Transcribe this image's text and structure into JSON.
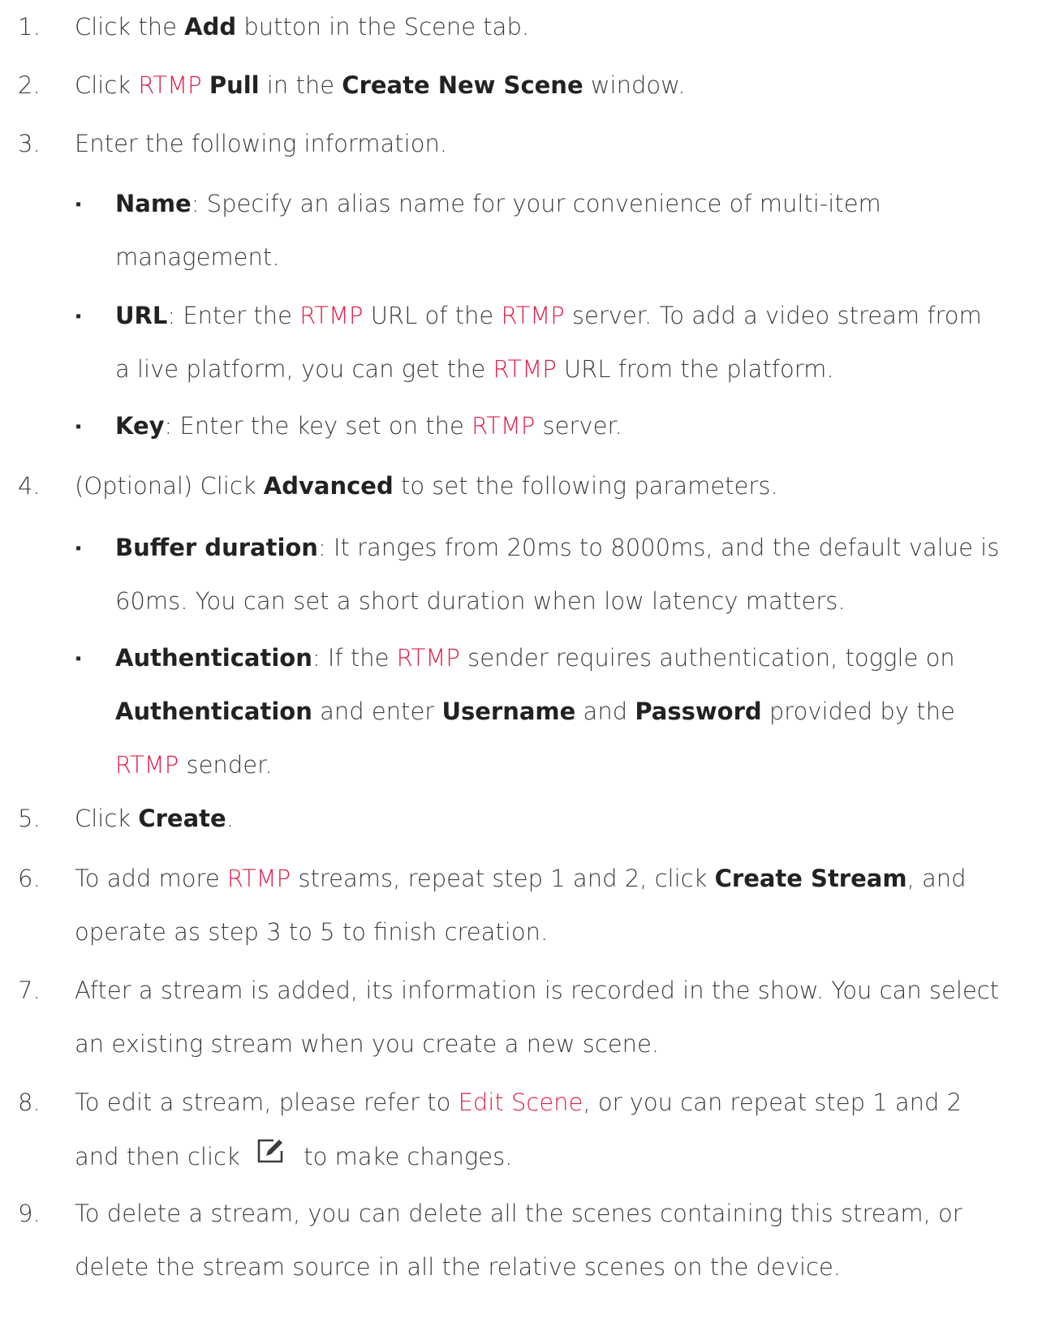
{
  "colors": {
    "accent": "#e0204a",
    "text": "#3c3c3c"
  },
  "steps": [
    {
      "num": "1.",
      "parts": [
        {
          "t": "Click the "
        },
        {
          "t": "Add",
          "b": true
        },
        {
          "t": " button in the Scene tab."
        }
      ]
    },
    {
      "num": "2.",
      "parts": [
        {
          "t": "Click "
        },
        {
          "t": "RTMP",
          "r": true
        },
        {
          "t": " "
        },
        {
          "t": "Pull",
          "b": true
        },
        {
          "t": " in the "
        },
        {
          "t": "Create New Scene",
          "b": true
        },
        {
          "t": " window."
        }
      ]
    },
    {
      "num": "3.",
      "parts": [
        {
          "t": "Enter the following information."
        }
      ]
    },
    {
      "num": "4.",
      "parts": [
        {
          "t": "(Optional) Click "
        },
        {
          "t": "Advanced",
          "b": true
        },
        {
          "t": " to set the following parameters."
        }
      ]
    },
    {
      "num": "5.",
      "parts": [
        {
          "t": "Click "
        },
        {
          "t": "Create",
          "b": true
        },
        {
          "t": "."
        }
      ]
    },
    {
      "num": "6.",
      "line1": [
        {
          "t": "To add more "
        },
        {
          "t": "RTMP",
          "r": true
        },
        {
          "t": " streams, repeat step 1 and 2, click "
        },
        {
          "t": "Create Stream",
          "b": true
        },
        {
          "t": ", and"
        }
      ],
      "line2": [
        {
          "t": "operate as step 3 to 5 to finish creation."
        }
      ]
    },
    {
      "num": "7.",
      "line1": [
        {
          "t": "After a stream is added, its information is recorded in the show. You can select"
        }
      ],
      "line2": [
        {
          "t": "an existing stream when you create a new scene."
        }
      ]
    },
    {
      "num": "8.",
      "line1": [
        {
          "t": "To edit a stream, please refer to "
        },
        {
          "t": "Edit Scene",
          "r": true
        },
        {
          "t": ", or you can repeat step 1 and 2"
        }
      ],
      "line2_before": "and then click",
      "line2_after": "to make changes.",
      "icon": "edit-icon"
    },
    {
      "num": "9.",
      "line1": [
        {
          "t": "To delete a stream, you can delete all the scenes containing this stream, or"
        }
      ],
      "line2": [
        {
          "t": "delete the stream source in all the relative scenes on the device."
        }
      ]
    }
  ],
  "sub3": [
    {
      "line1": [
        {
          "t": "Name",
          "b": true
        },
        {
          "t": ": Specify an alias name for your convenience of multi-item"
        }
      ],
      "line2": [
        {
          "t": "management."
        }
      ]
    },
    {
      "line1": [
        {
          "t": "URL",
          "b": true
        },
        {
          "t": ": Enter the "
        },
        {
          "t": "RTMP",
          "r": true
        },
        {
          "t": " URL of the "
        },
        {
          "t": "RTMP",
          "r": true
        },
        {
          "t": " server. To add a video stream from"
        }
      ],
      "line2": [
        {
          "t": "a live platform, you can get the "
        },
        {
          "t": "RTMP",
          "r": true
        },
        {
          "t": " URL from the platform."
        }
      ]
    },
    {
      "line1": [
        {
          "t": "Key",
          "b": true
        },
        {
          "t": ": Enter the key set on the "
        },
        {
          "t": "RTMP",
          "r": true
        },
        {
          "t": " server."
        }
      ]
    }
  ],
  "sub4": [
    {
      "line1": [
        {
          "t": "Buffer duration",
          "b": true
        },
        {
          "t": ": It ranges from 20ms to 8000ms, and the default value is"
        }
      ],
      "line2": [
        {
          "t": "60ms. You can set a short duration when low latency matters."
        }
      ]
    },
    {
      "line1": [
        {
          "t": "Authentication",
          "b": true
        },
        {
          "t": ": If the "
        },
        {
          "t": "RTMP",
          "r": true
        },
        {
          "t": " sender requires authentication, toggle on"
        }
      ],
      "line2": [
        {
          "t": "Authentication",
          "b": true
        },
        {
          "t": " and enter "
        },
        {
          "t": "Username",
          "b": true
        },
        {
          "t": " and "
        },
        {
          "t": "Password",
          "b": true
        },
        {
          "t": " provided by the"
        }
      ],
      "line3": [
        {
          "t": "RTMP",
          "r": true
        },
        {
          "t": " sender."
        }
      ]
    }
  ],
  "bullet_glyph": "▪"
}
